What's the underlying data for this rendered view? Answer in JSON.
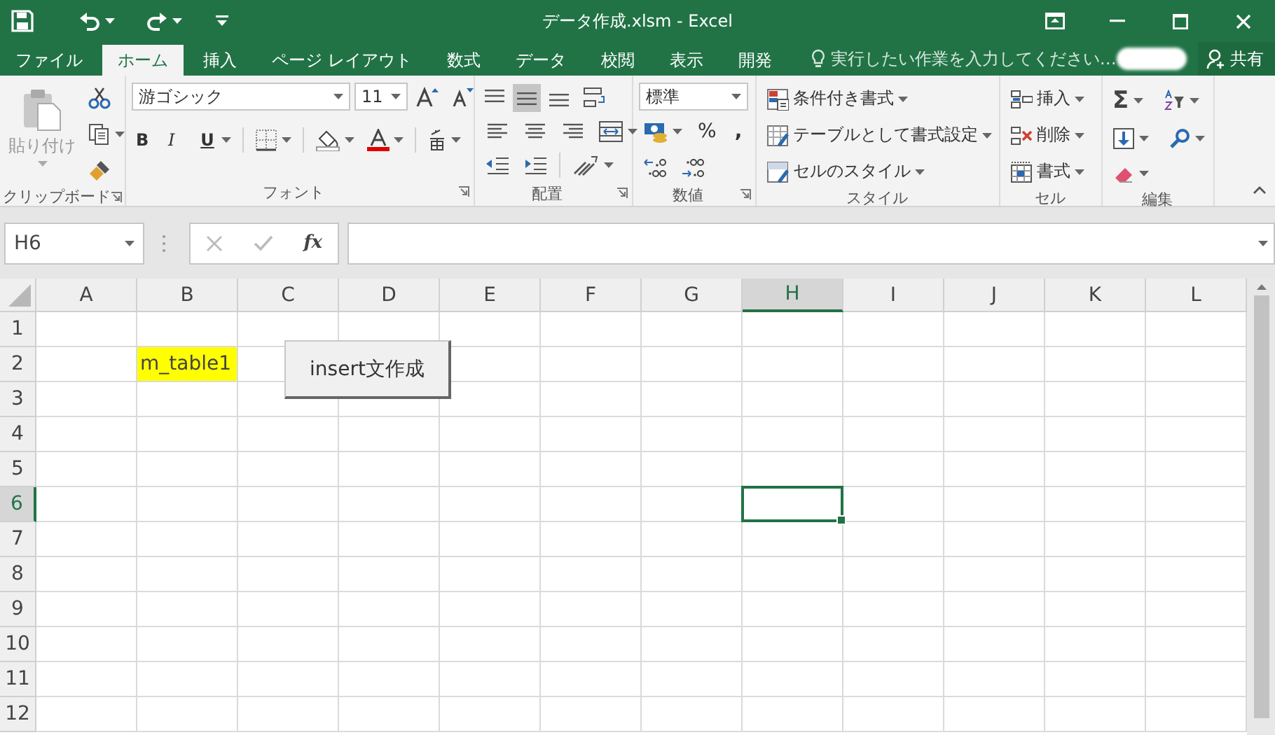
{
  "title_bar": {
    "title": "データ作成.xlsm - Excel"
  },
  "tabs": [
    {
      "label": "ファイル",
      "selected": false
    },
    {
      "label": "ホーム",
      "selected": true
    },
    {
      "label": "挿入",
      "selected": false
    },
    {
      "label": "ページ レイアウト",
      "selected": false
    },
    {
      "label": "数式",
      "selected": false
    },
    {
      "label": "データ",
      "selected": false
    },
    {
      "label": "校閲",
      "selected": false
    },
    {
      "label": "表示",
      "selected": false
    },
    {
      "label": "開発",
      "selected": false
    }
  ],
  "tell_me": {
    "placeholder": "実行したい作業を入力してください…"
  },
  "share": {
    "label": "共有"
  },
  "ribbon": {
    "groups": [
      {
        "kind": "clipboard",
        "label": "クリップボード",
        "paste": {
          "label": "貼り付け",
          "disabled": true
        }
      },
      {
        "kind": "font",
        "label": "フォント",
        "font_name": "游ゴシック",
        "font_size": "11",
        "bold": "B",
        "italic": "I",
        "underline": "U"
      },
      {
        "kind": "alignment",
        "label": "配置"
      },
      {
        "kind": "number",
        "label": "数値",
        "format": "標準",
        "percent": "%",
        "comma": ","
      },
      {
        "kind": "styles",
        "label": "スタイル",
        "items": [
          "条件付き書式",
          "テーブルとして書式設定",
          "セルのスタイル"
        ]
      },
      {
        "kind": "cells",
        "label": "セル",
        "items": [
          "挿入",
          "削除",
          "書式"
        ]
      },
      {
        "kind": "editing",
        "label": "編集",
        "autosum": "Σ"
      }
    ]
  },
  "formula_bar": {
    "name_box": "H6",
    "function_label": "fx"
  },
  "sheet": {
    "columns": [
      {
        "label": "A",
        "selected": false
      },
      {
        "label": "B",
        "selected": false
      },
      {
        "label": "C",
        "selected": false
      },
      {
        "label": "D",
        "selected": false
      },
      {
        "label": "E",
        "selected": false
      },
      {
        "label": "F",
        "selected": false
      },
      {
        "label": "G",
        "selected": false
      },
      {
        "label": "H",
        "selected": true
      },
      {
        "label": "I",
        "selected": false
      },
      {
        "label": "J",
        "selected": false
      },
      {
        "label": "K",
        "selected": false
      },
      {
        "label": "L",
        "selected": false
      }
    ],
    "rows": [
      {
        "label": "1",
        "selected": false
      },
      {
        "label": "2",
        "selected": false,
        "cells": [
          null,
          {
            "text": "m_table1",
            "color": "#ffff00"
          }
        ]
      },
      {
        "label": "3",
        "selected": false
      },
      {
        "label": "4",
        "selected": false
      },
      {
        "label": "5",
        "selected": false
      },
      {
        "label": "6",
        "selected": true,
        "cells": [
          null,
          null,
          null,
          null,
          null,
          null,
          null,
          {
            "selected": true
          }
        ]
      },
      {
        "label": "7",
        "selected": false
      },
      {
        "label": "8",
        "selected": false
      },
      {
        "label": "9",
        "selected": false
      },
      {
        "label": "10",
        "selected": false
      },
      {
        "label": "11",
        "selected": false
      },
      {
        "label": "12",
        "selected": false
      }
    ],
    "form_button": {
      "label": "insert文作成"
    }
  }
}
